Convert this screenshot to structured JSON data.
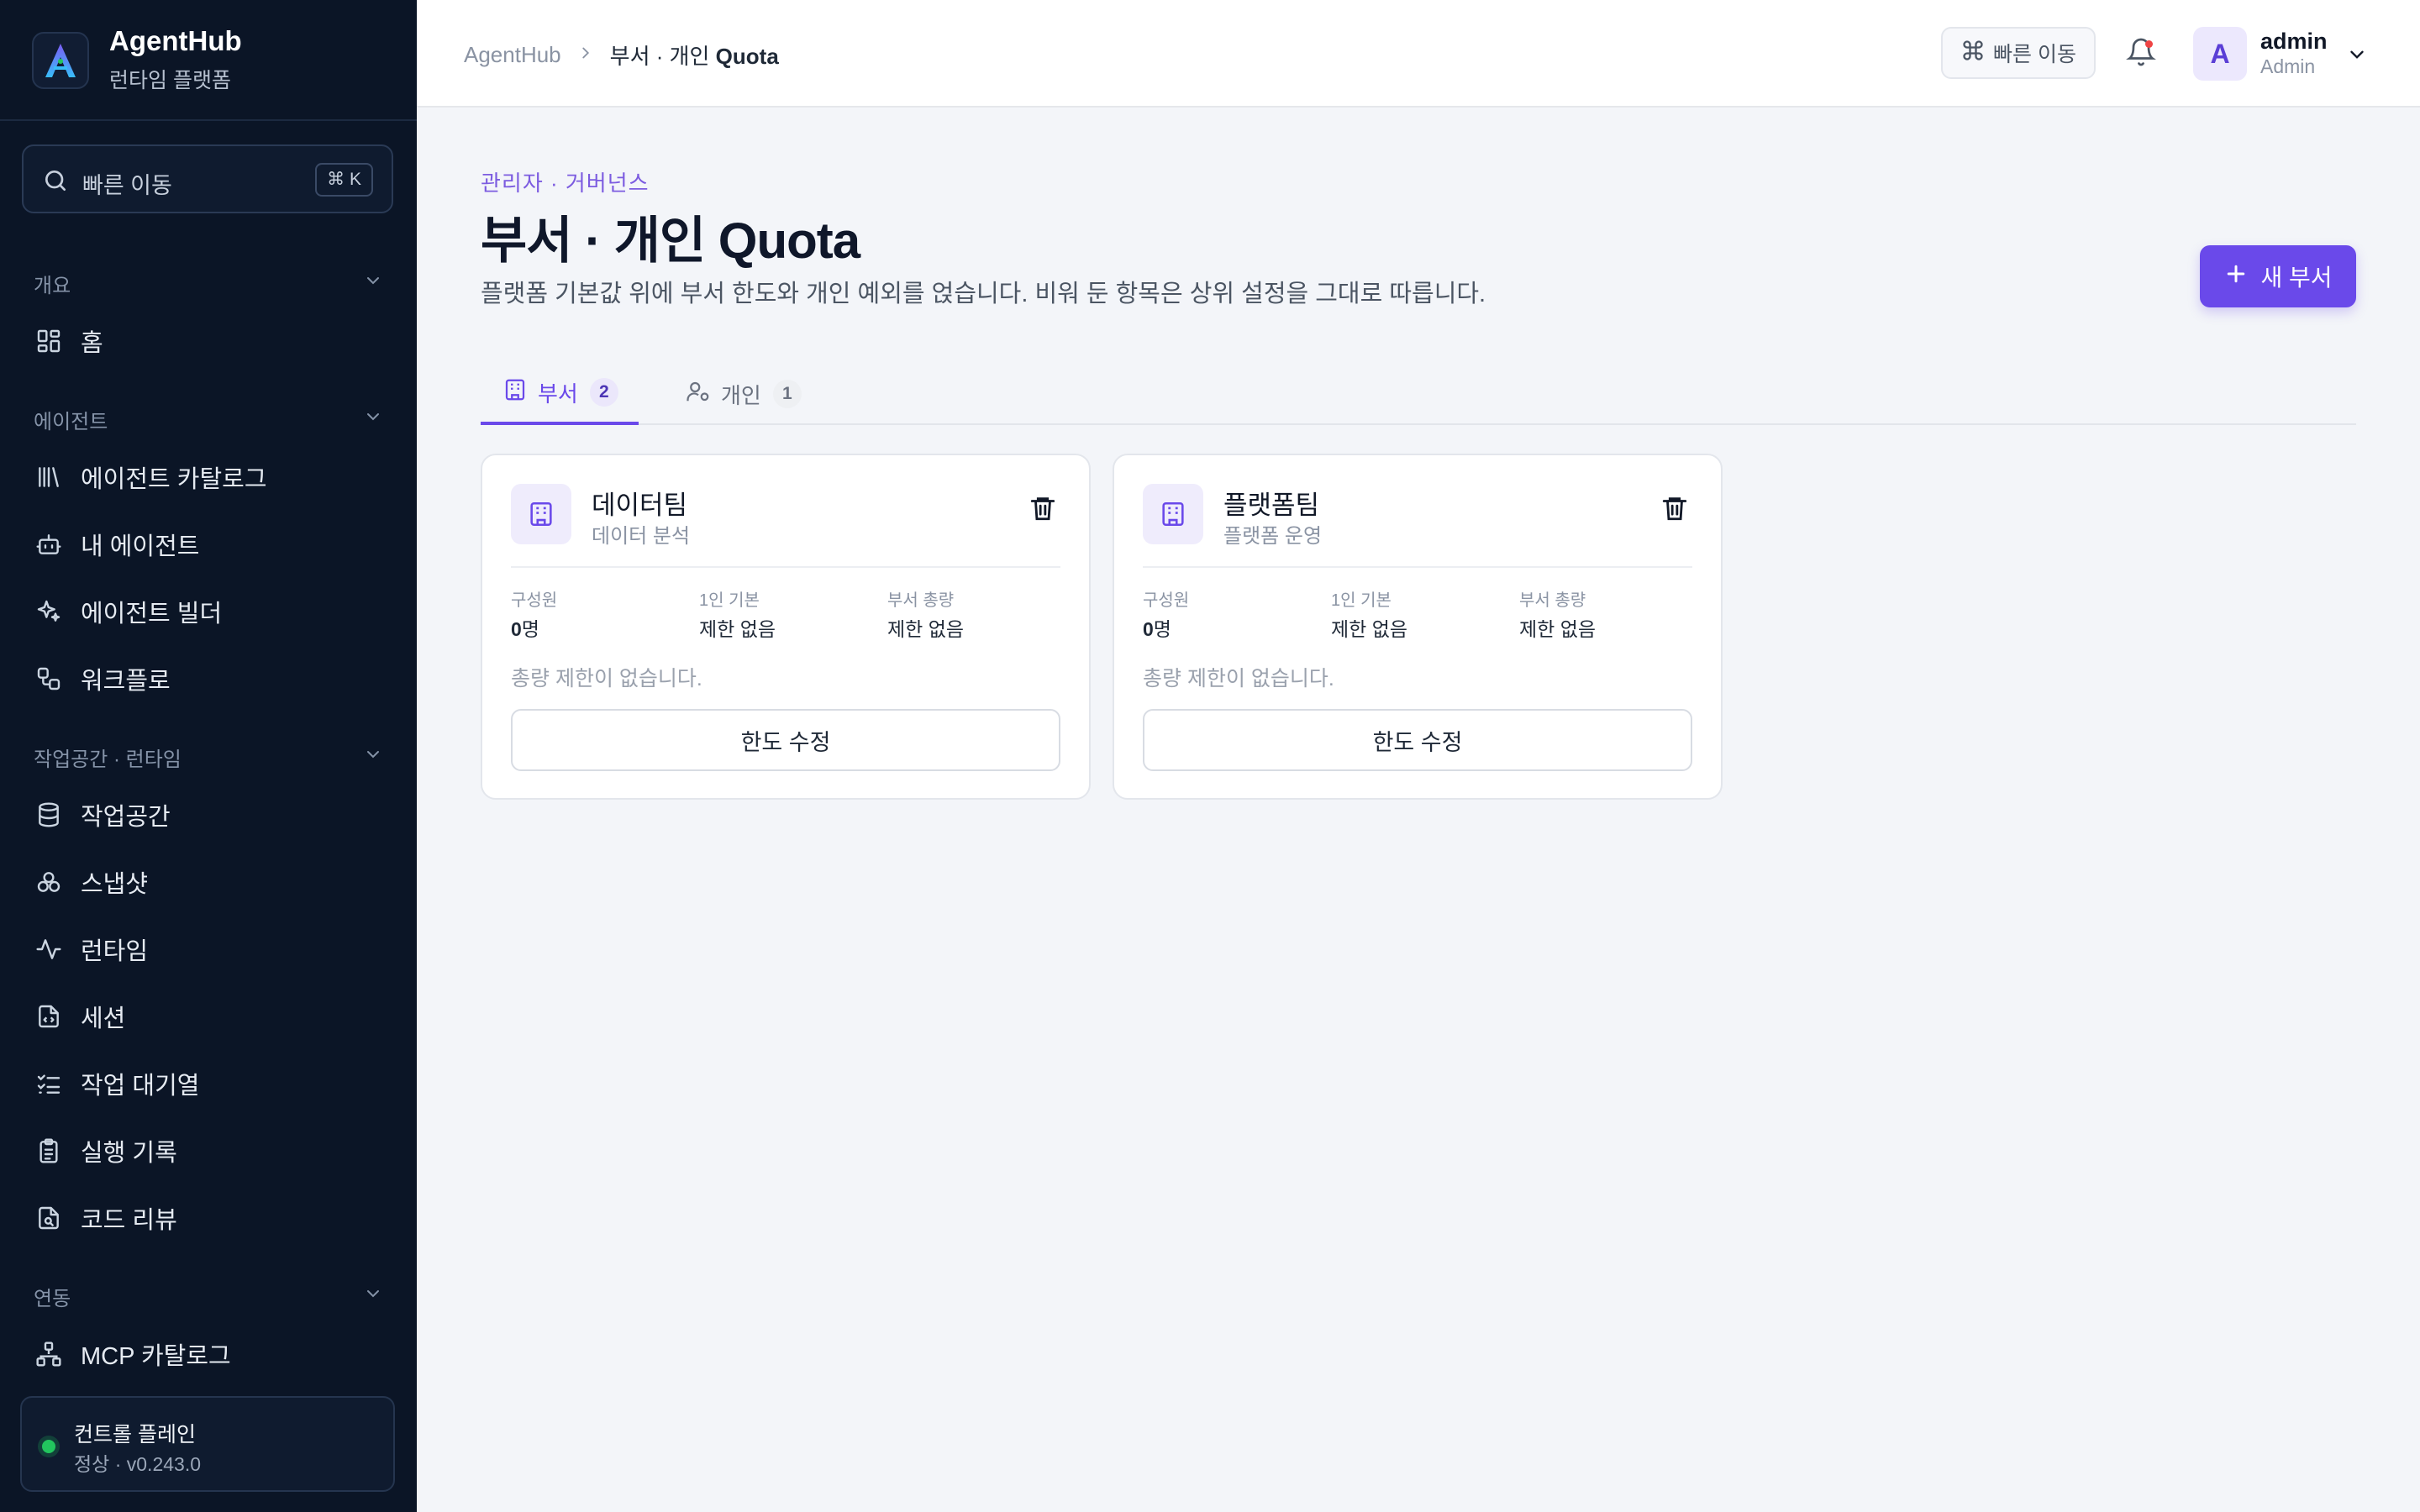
{
  "app": {
    "name": "AgentHub",
    "subtitle": "런타임 플랫폼"
  },
  "sidebar": {
    "search": {
      "label": "빠른 이동",
      "shortcut": "⌘ K"
    },
    "sections": [
      {
        "title": "개요",
        "items": [
          {
            "label": "홈",
            "icon": "grid-icon"
          }
        ]
      },
      {
        "title": "에이전트",
        "items": [
          {
            "label": "에이전트 카탈로그",
            "icon": "library-icon"
          },
          {
            "label": "내 에이전트",
            "icon": "bot-icon"
          },
          {
            "label": "에이전트 빌더",
            "icon": "sparkles-icon"
          },
          {
            "label": "워크플로",
            "icon": "workflow-icon"
          }
        ]
      },
      {
        "title": "작업공간 · 런타임",
        "items": [
          {
            "label": "작업공간",
            "icon": "database-icon"
          },
          {
            "label": "스냅샷",
            "icon": "boxes-icon"
          },
          {
            "label": "런타임",
            "icon": "activity-icon"
          },
          {
            "label": "세션",
            "icon": "file-code-icon"
          },
          {
            "label": "작업 대기열",
            "icon": "list-checks-icon"
          },
          {
            "label": "실행 기록",
            "icon": "clipboard-icon"
          },
          {
            "label": "코드 리뷰",
            "icon": "file-search-icon"
          }
        ]
      },
      {
        "title": "연동",
        "items": [
          {
            "label": "MCP 카탈로그",
            "icon": "network-icon"
          }
        ]
      }
    ],
    "status": {
      "title": "컨트롤 플레인",
      "detail": "정상 · v0.243.0",
      "color": "#22c55e"
    }
  },
  "topbar": {
    "breadcrumb": {
      "root": "AgentHub",
      "current_prefix": "부서 · 개인 ",
      "current_strong": "Quota"
    },
    "quick_label": "빠른 이동",
    "user": {
      "initial": "A",
      "name": "admin",
      "role": "Admin"
    }
  },
  "page": {
    "eyebrow": "관리자 · 거버넌스",
    "title_prefix": "부서 · 개인 ",
    "title_strong": "Quota",
    "description": "플랫폼 기본값 위에 부서 한도와 개인 예외를 얹습니다. 비워 둔 항목은 상위 설정을 그대로 따릅니다.",
    "new_button": "새 부서",
    "accent": "#6a49ea"
  },
  "tabs": [
    {
      "label": "부서",
      "count": "2",
      "active": true
    },
    {
      "label": "개인",
      "count": "1",
      "active": false
    }
  ],
  "stat_labels": {
    "members": "구성원",
    "per_person": "1인 기본",
    "total": "부서 총량"
  },
  "cards": [
    {
      "title": "데이터팀",
      "subtitle": "데이터 분석",
      "members_num": "0",
      "members_unit": "명",
      "per_person": "제한 없음",
      "total": "제한 없음",
      "note": "총량 제한이 없습니다.",
      "edit_label": "한도 수정"
    },
    {
      "title": "플랫폼팀",
      "subtitle": "플랫폼 운영",
      "members_num": "0",
      "members_unit": "명",
      "per_person": "제한 없음",
      "total": "제한 없음",
      "note": "총량 제한이 없습니다.",
      "edit_label": "한도 수정"
    }
  ]
}
